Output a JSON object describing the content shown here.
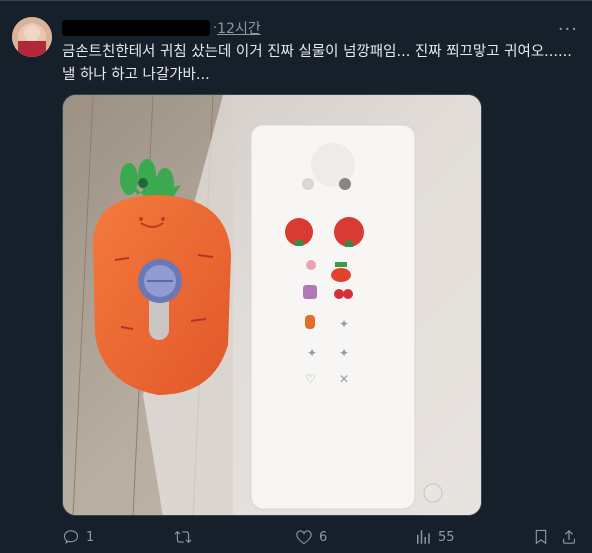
{
  "tweet": {
    "time": "12시간",
    "separator": "·",
    "verified_mark": "·",
    "more": "···",
    "text": "금손트친한테서 귀침 샀는데 이거 진짜 실물이 넘깡패임... 진짜 쬐끄맣고 귀여오......\n낼 하나 하고 나갈가바...",
    "actions": {
      "reply_count": "1",
      "retweet_count": "",
      "like_count": "6",
      "views_count": "55"
    }
  }
}
